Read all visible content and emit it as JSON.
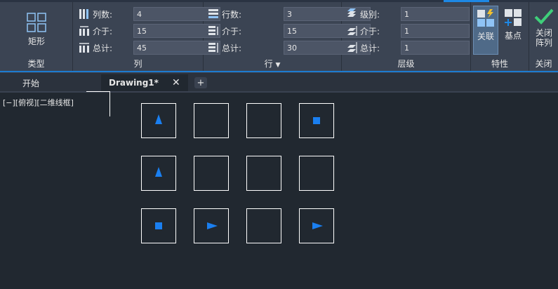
{
  "panels": {
    "type": {
      "button_label": "矩形",
      "title": "类型"
    },
    "column": {
      "title": "列",
      "fields": [
        {
          "label": "列数:",
          "value": "4"
        },
        {
          "label": "介于:",
          "value": "15"
        },
        {
          "label": "总计:",
          "value": "45"
        }
      ]
    },
    "row": {
      "title": "行",
      "fields": [
        {
          "label": "行数:",
          "value": "3"
        },
        {
          "label": "介于:",
          "value": "15"
        },
        {
          "label": "总计:",
          "value": "30"
        }
      ]
    },
    "level": {
      "title": "层级",
      "fields": [
        {
          "label": "级别:",
          "value": "1"
        },
        {
          "label": "介于:",
          "value": "1"
        },
        {
          "label": "总计:",
          "value": "1"
        }
      ]
    },
    "properties": {
      "title": "特性",
      "associate_label": "关联",
      "basepoint_label": "基点"
    },
    "close": {
      "title": "关闭",
      "button_line1": "关闭",
      "button_line2": "阵列"
    }
  },
  "tabs": [
    {
      "label": "开始",
      "active": false
    },
    {
      "label": "Drawing1*",
      "active": true
    }
  ],
  "viewport_label": "[−][俯视][二维线框]",
  "grid": {
    "rows": 3,
    "cols": 4,
    "cell_shapes": [
      [
        "triangle-up",
        "empty",
        "empty",
        "square"
      ],
      [
        "triangle-up",
        "empty",
        "empty",
        "empty"
      ],
      [
        "square",
        "triangle-right",
        "empty",
        "triangle-right"
      ]
    ]
  },
  "colors": {
    "accent": "#1d88e5",
    "shape": "#1a7ff0",
    "canvas": "#212830"
  }
}
